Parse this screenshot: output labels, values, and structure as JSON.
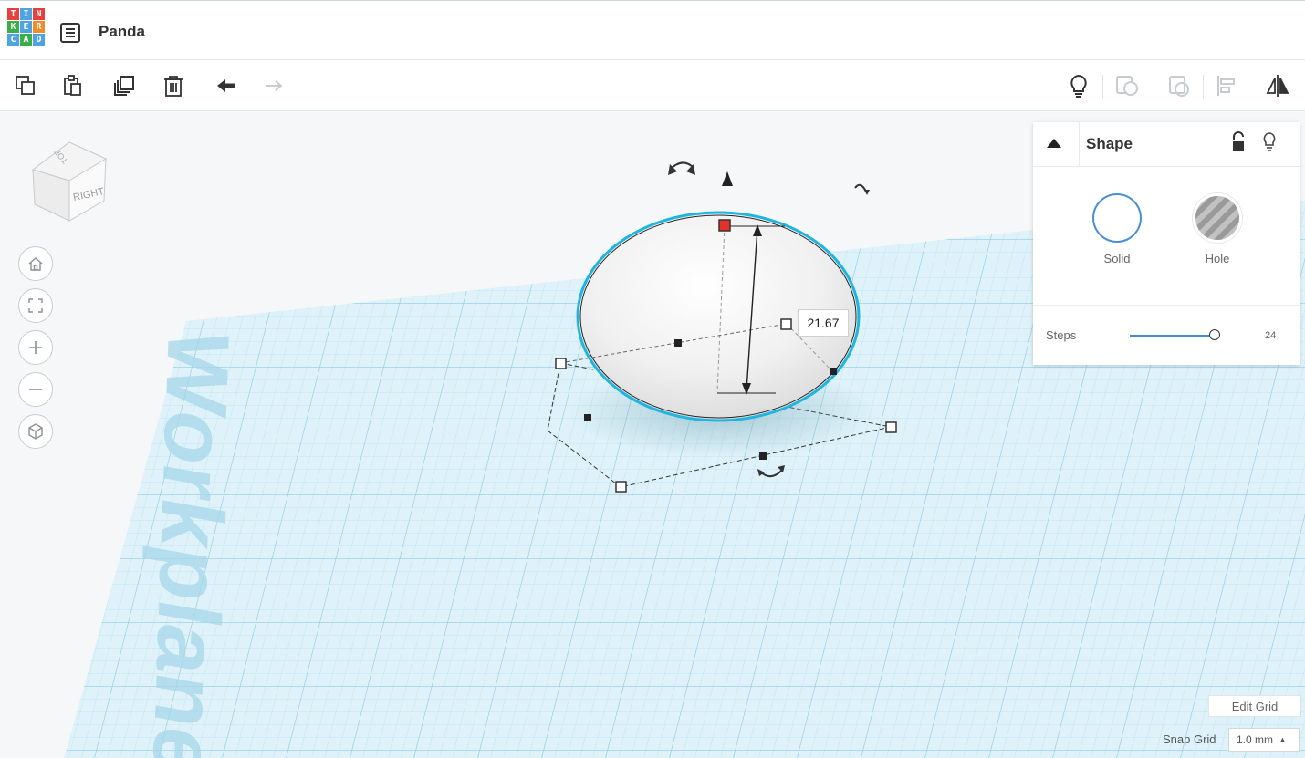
{
  "app": {
    "logo_letters": [
      "T",
      "I",
      "N",
      "K",
      "E",
      "R",
      "C",
      "A",
      "D"
    ],
    "logo_colors": [
      "#e83f3f",
      "#4fa3e0",
      "#e83f3f",
      "#3bae4a",
      "#4fa3e0",
      "#f28c28",
      "#4fa3e0",
      "#3bae4a",
      "#4fa3e0"
    ],
    "design_title": "Panda"
  },
  "toolbar": {
    "left_tools": [
      "copy-icon",
      "paste-icon",
      "duplicate-icon",
      "delete-icon",
      "undo-icon",
      "redo-icon"
    ],
    "right_tools": [
      "show-all-icon",
      "group-icon",
      "ungroup-icon",
      "align-icon",
      "mirror-icon"
    ]
  },
  "viewcube": {
    "face_top": "TOP",
    "face_right": "RIGHT"
  },
  "nav_buttons": [
    "home-view-icon",
    "fit-view-icon",
    "zoom-in-icon",
    "zoom-out-icon",
    "perspective-icon"
  ],
  "workplane": {
    "label": "Workplane",
    "grid_color": "#bfe6f2"
  },
  "selection": {
    "height_value": "21.67",
    "outline_color": "#1fb5e0",
    "top_handle_color": "#e8302b"
  },
  "shape_panel": {
    "title": "Shape",
    "options": [
      {
        "label": "Solid",
        "color": "#4a8fd6"
      },
      {
        "label": "Hole"
      }
    ],
    "steps_label": "Steps",
    "steps_value": "24",
    "steps_fraction": 0.95
  },
  "grid_controls": {
    "edit_grid_label": "Edit Grid",
    "snap_grid_label": "Snap Grid",
    "snap_grid_value": "1.0 mm"
  }
}
